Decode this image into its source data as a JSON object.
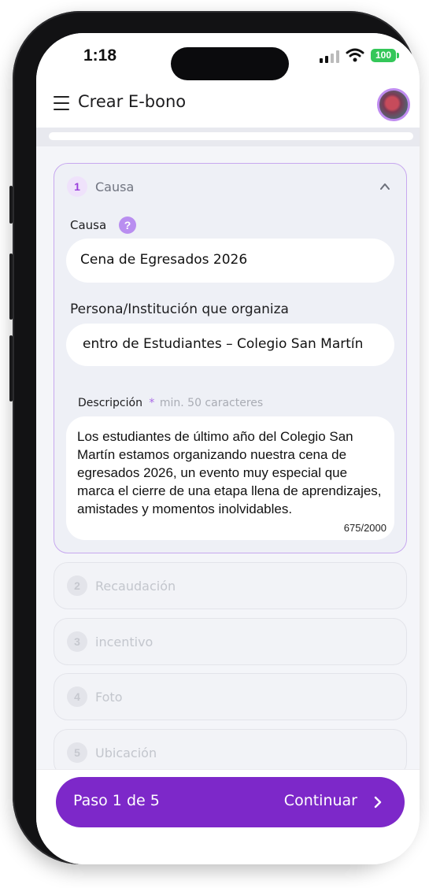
{
  "status": {
    "time": "1:18",
    "battery": "100"
  },
  "header": {
    "title": "Crear E-bono"
  },
  "steps": [
    {
      "number": "1",
      "label": "Causa"
    },
    {
      "number": "2",
      "label": "Recaudación"
    },
    {
      "number": "3",
      "label": "incentivo"
    },
    {
      "number": "4",
      "label": "Foto"
    },
    {
      "number": "5",
      "label": "Ubicación"
    }
  ],
  "form": {
    "cause_label": "Causa",
    "help_symbol": "?",
    "cause_value": "Cena de Egresados 2026",
    "organizer_label": "Persona/Institución que organiza",
    "organizer_value": "entro de Estudiantes – Colegio San Martín",
    "description_label": "Descripción",
    "required_mark": "*",
    "description_hint": "min. 50 caracteres",
    "description_value": "Los estudiantes de último año del Colegio San Martín estamos organizando nuestra cena de egresados 2026, un evento muy especial que marca el cierre de una etapa llena de aprendizajes, amistades y momentos inolvidables.",
    "char_count": "675/2000"
  },
  "footer": {
    "progress_text": "Paso 1 de 5",
    "continue_label": "Continuar"
  },
  "colors": {
    "accent": "#7d28c9",
    "help": "#b98ef0",
    "active_border": "#c7a8ef"
  }
}
